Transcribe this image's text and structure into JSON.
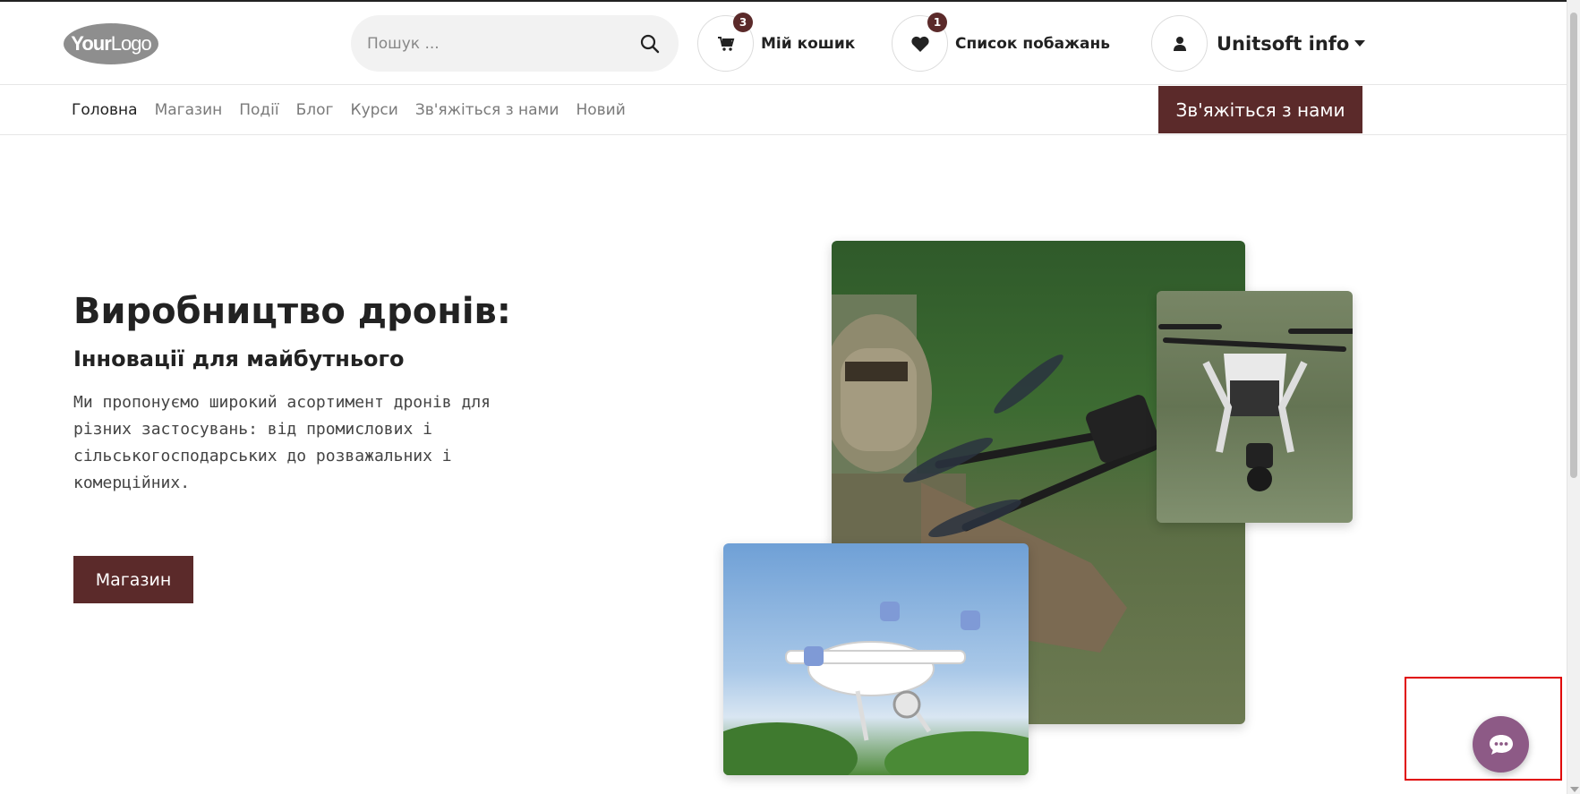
{
  "header": {
    "logo": {
      "part1": "Your",
      "part2": "Logo"
    },
    "search": {
      "placeholder": "Пошук ..."
    },
    "cart": {
      "label": "Мій кошик",
      "count": "3"
    },
    "wishlist": {
      "label": "Список побажань",
      "count": "1"
    },
    "user": {
      "label": "Unitsoft info"
    }
  },
  "nav": {
    "items": [
      {
        "label": "Головна",
        "active": true
      },
      {
        "label": "Магазин"
      },
      {
        "label": "Події"
      },
      {
        "label": "Блог"
      },
      {
        "label": "Курси"
      },
      {
        "label": "Зв'яжіться з нами"
      },
      {
        "label": "Новий"
      }
    ],
    "cta": "Зв'яжіться з нами"
  },
  "hero": {
    "title": "Виробництво дронів:",
    "subtitle": "Інновації для майбутнього",
    "text": "Ми пропонуємо широкий асортимент дронів для різних застосувань: від промислових і сільськогосподарських до розважальних і комерційних.",
    "button": "Магазин"
  },
  "colors": {
    "brand": "#5b2a2a",
    "chat": "#8d5a86",
    "highlight": "#e00000"
  },
  "icons": {
    "search": "search-icon",
    "cart": "cart-icon",
    "wishlist": "heart-icon",
    "user": "user-icon",
    "chat": "chat-icon"
  }
}
